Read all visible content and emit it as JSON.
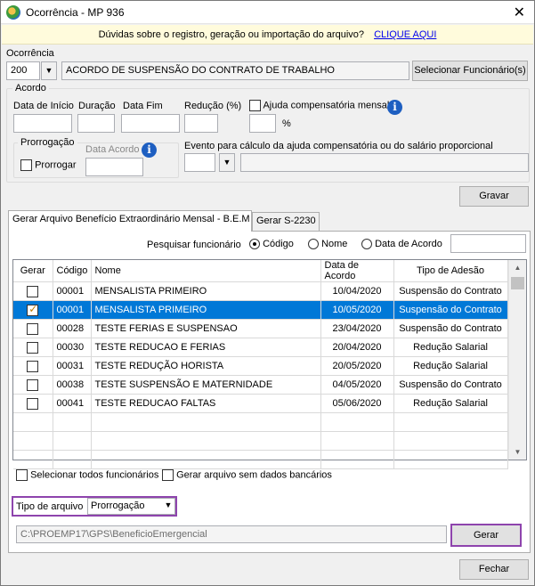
{
  "window": {
    "title": "Ocorrência - MP 936"
  },
  "infobar": {
    "text": "Dúvidas sobre o registro, geração ou importação do arquivo?",
    "link": "CLIQUE AQUI"
  },
  "ocorrencia": {
    "label": "Ocorrência",
    "code": "200",
    "description": "ACORDO DE SUSPENSÃO DO CONTRATO DE TRABALHO",
    "select_button": "Selecionar Funcionário(s)"
  },
  "acordo": {
    "group_label": "Acordo",
    "data_inicio_label": "Data de Início",
    "duracao_label": "Duração",
    "data_fim_label": "Data Fim",
    "reducao_label": "Redução (%)",
    "ajuda_label": "Ajuda compensatória mensal",
    "percent_symbol": "%",
    "prorrogacao": {
      "group_label": "Prorrogação",
      "prorrogar_label": "Prorrogar",
      "data_acordo_label": "Data Acordo"
    },
    "evento_label": "Evento para cálculo da ajuda compensatória ou do salário proporcional"
  },
  "save_button": "Gravar",
  "tabs": [
    {
      "label": "Gerar Arquivo Benefício Extraordinário Mensal - B.E.M"
    },
    {
      "label": "Gerar S-2230"
    }
  ],
  "search": {
    "label": "Pesquisar funcionário",
    "options": [
      "Código",
      "Nome",
      "Data de Acordo"
    ],
    "selected": "Código"
  },
  "grid": {
    "columns": [
      "Gerar",
      "Código",
      "Nome",
      "Data de Acordo",
      "Tipo de Adesão"
    ],
    "rows": [
      {
        "gerar": false,
        "codigo": "00001",
        "nome": "MENSALISTA PRIMEIRO",
        "data": "10/04/2020",
        "tipo": "Suspensão do Contrato"
      },
      {
        "gerar": true,
        "codigo": "00001",
        "nome": "MENSALISTA PRIMEIRO",
        "data": "10/05/2020",
        "tipo": "Suspensão do Contrato"
      },
      {
        "gerar": false,
        "codigo": "00028",
        "nome": "TESTE FERIAS E SUSPENSAO",
        "data": "23/04/2020",
        "tipo": "Suspensão do Contrato"
      },
      {
        "gerar": false,
        "codigo": "00030",
        "nome": "TESTE REDUCAO E FERIAS",
        "data": "20/04/2020",
        "tipo": "Redução Salarial"
      },
      {
        "gerar": false,
        "codigo": "00031",
        "nome": "TESTE REDUÇÃO HORISTA",
        "data": "20/05/2020",
        "tipo": "Redução Salarial"
      },
      {
        "gerar": false,
        "codigo": "00038",
        "nome": "TESTE SUSPENSÃO E MATERNIDADE",
        "data": "04/05/2020",
        "tipo": "Suspensão do Contrato"
      },
      {
        "gerar": false,
        "codigo": "00041",
        "nome": "TESTE REDUCAO FALTAS",
        "data": "05/06/2020",
        "tipo": "Redução Salarial"
      }
    ]
  },
  "select_all_label": "Selecionar todos funcionários",
  "no_bank_label": "Gerar arquivo sem dados bancários",
  "tipo_arquivo": {
    "label": "Tipo de arquivo",
    "value": "Prorrogação"
  },
  "path": "C:\\PROEMP17\\GPS\\BeneficioEmergencial",
  "generate_button": "Gerar",
  "close_button": "Fechar",
  "colors": {
    "selection": "#0078d7",
    "highlight": "#8e44ad",
    "link": "#0000ee"
  }
}
